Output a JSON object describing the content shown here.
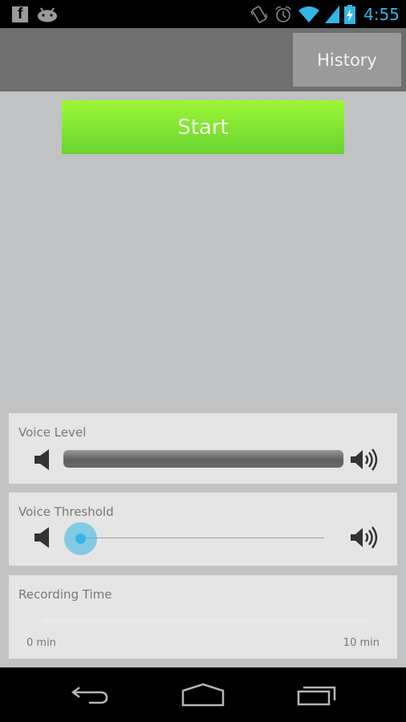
{
  "status_bar": {
    "left_icons": [
      "facebook-icon",
      "android-icon"
    ],
    "right_icons": [
      "vibrate-icon",
      "alarm-icon",
      "wifi-icon",
      "signal-icon",
      "battery-charging-icon"
    ],
    "time": "4:55",
    "accent_color": "#33b5e5"
  },
  "action_bar": {
    "history_label": "History"
  },
  "main": {
    "start_label": "Start",
    "start_color": "#7ee233"
  },
  "voice_level": {
    "title": "Voice Level",
    "min_icon": "volume-low-icon",
    "max_icon": "volume-high-icon",
    "level": 1.0
  },
  "voice_threshold": {
    "title": "Voice Threshold",
    "min_icon": "volume-low-icon",
    "max_icon": "volume-high-icon",
    "value": 0.0
  },
  "recording_time": {
    "title": "Recording Time",
    "min_label": "0 min",
    "max_label": "10 min",
    "progress": 0.0
  },
  "nav_bar": {
    "buttons": [
      "back",
      "home",
      "recents"
    ]
  }
}
